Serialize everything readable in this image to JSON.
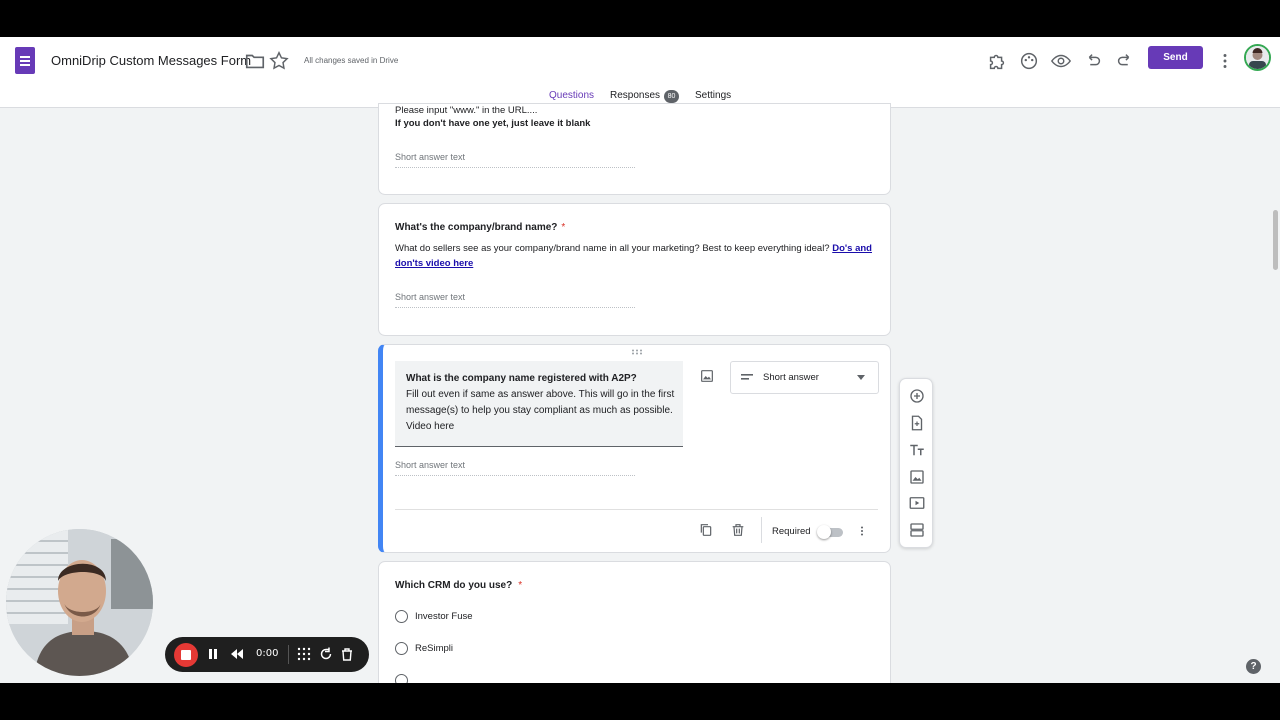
{
  "header": {
    "doc_title": "OmniDrip Custom Messages Form",
    "save_status": "All changes saved in Drive",
    "send_label": "Send"
  },
  "tabs": {
    "questions": "Questions",
    "responses": "Responses",
    "responses_count": "80",
    "settings": "Settings"
  },
  "cards": {
    "prev": {
      "desc_line1": "Please input \"www.\" in the URL....",
      "desc_line2": "If you don't have one yet, just leave it blank",
      "placeholder": "Short answer text"
    },
    "brand": {
      "title": "What's the company/brand name?",
      "required_mark": "*",
      "desc": "What do sellers see as your company/brand name in all your marketing? Best to keep everything ideal?",
      "link": "Do's and don'ts video here",
      "placeholder": "Short answer text"
    },
    "a2p": {
      "title": "What is the company name registered with A2P?",
      "desc": "Fill out even if same as answer above. This will go in the first message(s) to help you stay compliant as much as possible. Video here",
      "type_label": "Short answer",
      "placeholder": "Short answer text",
      "required_label": "Required",
      "required_on": false
    },
    "crm": {
      "title": "Which CRM do you use?",
      "required_mark": "*",
      "options": [
        "Investor Fuse",
        "ReSimpli"
      ]
    }
  },
  "recorder": {
    "time": "0:00"
  },
  "help": "?",
  "colors": {
    "accent": "#673ab7",
    "active_border": "#4285f4",
    "required": "#d93025",
    "record": "#e53935"
  },
  "icons": [
    "forms-logo",
    "folder-icon",
    "star-icon",
    "addon-icon",
    "palette-icon",
    "preview-icon",
    "undo-icon",
    "redo-icon",
    "more-vert-icon",
    "image-icon",
    "dropdown-arrow-icon",
    "copy-icon",
    "delete-icon",
    "add-question-icon",
    "import-icon",
    "title-icon",
    "add-image-icon",
    "video-icon",
    "section-icon",
    "stop-icon",
    "pause-icon",
    "rewind-icon",
    "draw-icon",
    "restart-icon",
    "trash-icon"
  ]
}
